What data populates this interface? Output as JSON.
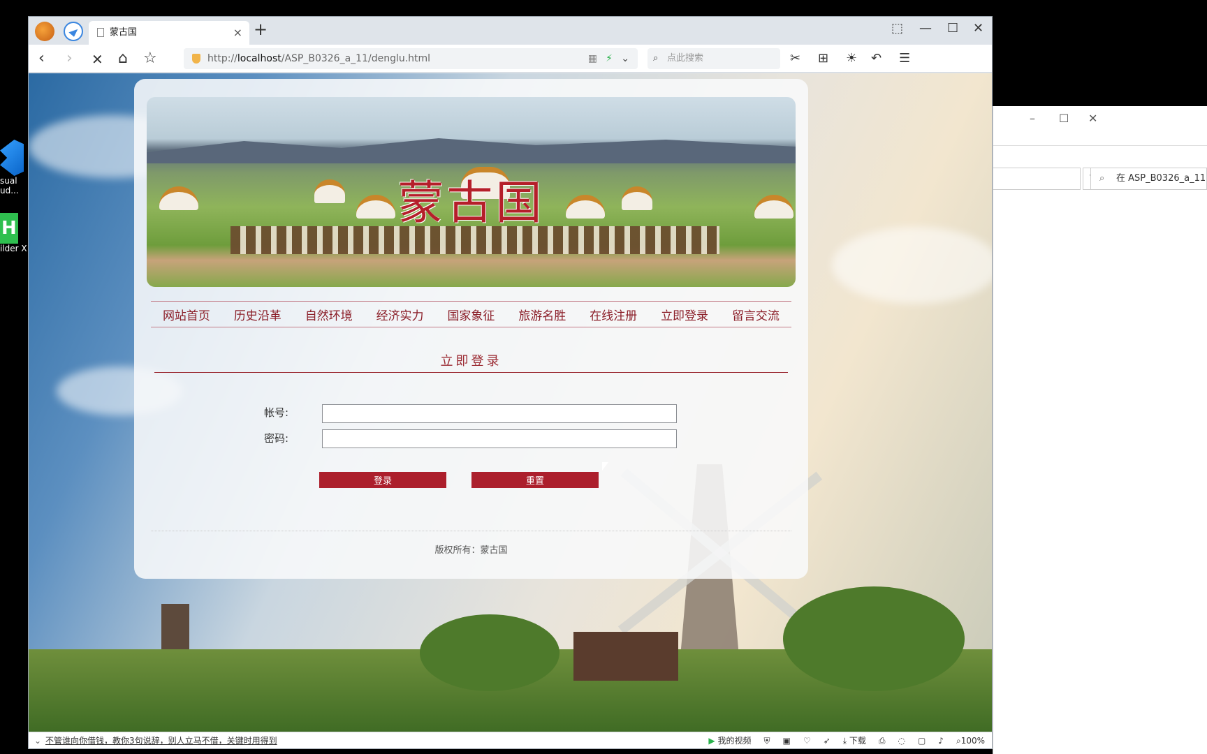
{
  "desktop": {
    "icons": [
      {
        "label": "sual\nud..."
      },
      {
        "label": "ilder X"
      }
    ]
  },
  "explorer": {
    "search_placeholder": "在 ASP_B0326_a_11...",
    "controls": {
      "min": "–",
      "max": "☐",
      "close": "✕"
    }
  },
  "browser": {
    "tab": {
      "title": "蒙古国",
      "close": "×"
    },
    "new_tab": "+",
    "window_controls": {
      "pin": "⌂",
      "min": "—",
      "max": "☐",
      "close": "✕"
    },
    "nav": {
      "back": "‹",
      "forward": "›",
      "stop": "✕",
      "home": "⌂",
      "star": "☆"
    },
    "url": {
      "prefix": "http://",
      "host": "localhost",
      "path": "/ASP_B0326_a_11/denglu.html"
    },
    "search_placeholder": "点此搜索",
    "toolbar_icons": [
      "scissors-icon",
      "apps-icon",
      "sun-icon",
      "undo-icon",
      "menu-icon"
    ]
  },
  "page": {
    "banner_title": "蒙古国",
    "menu": [
      "网站首页",
      "历史沿革",
      "自然环境",
      "经济实力",
      "国家象征",
      "旅游名胜",
      "在线注册",
      "立即登录",
      "留言交流"
    ],
    "section_title": "立即登录",
    "form": {
      "account_label": "帐号:",
      "account_value": "",
      "password_label": "密码:",
      "password_value": "",
      "login_button": "登录",
      "reset_button": "重置"
    },
    "footer": "版权所有：蒙古国"
  },
  "statusbar": {
    "message": "不管谁向你借钱，教你3句说辞，别人立马不借，关键时用得到",
    "items": [
      "我的视频",
      "下载",
      "100%"
    ]
  },
  "colors": {
    "accent": "#ac1f2c",
    "menu_text": "#8b1e28",
    "title_red": "#b51f2a"
  }
}
